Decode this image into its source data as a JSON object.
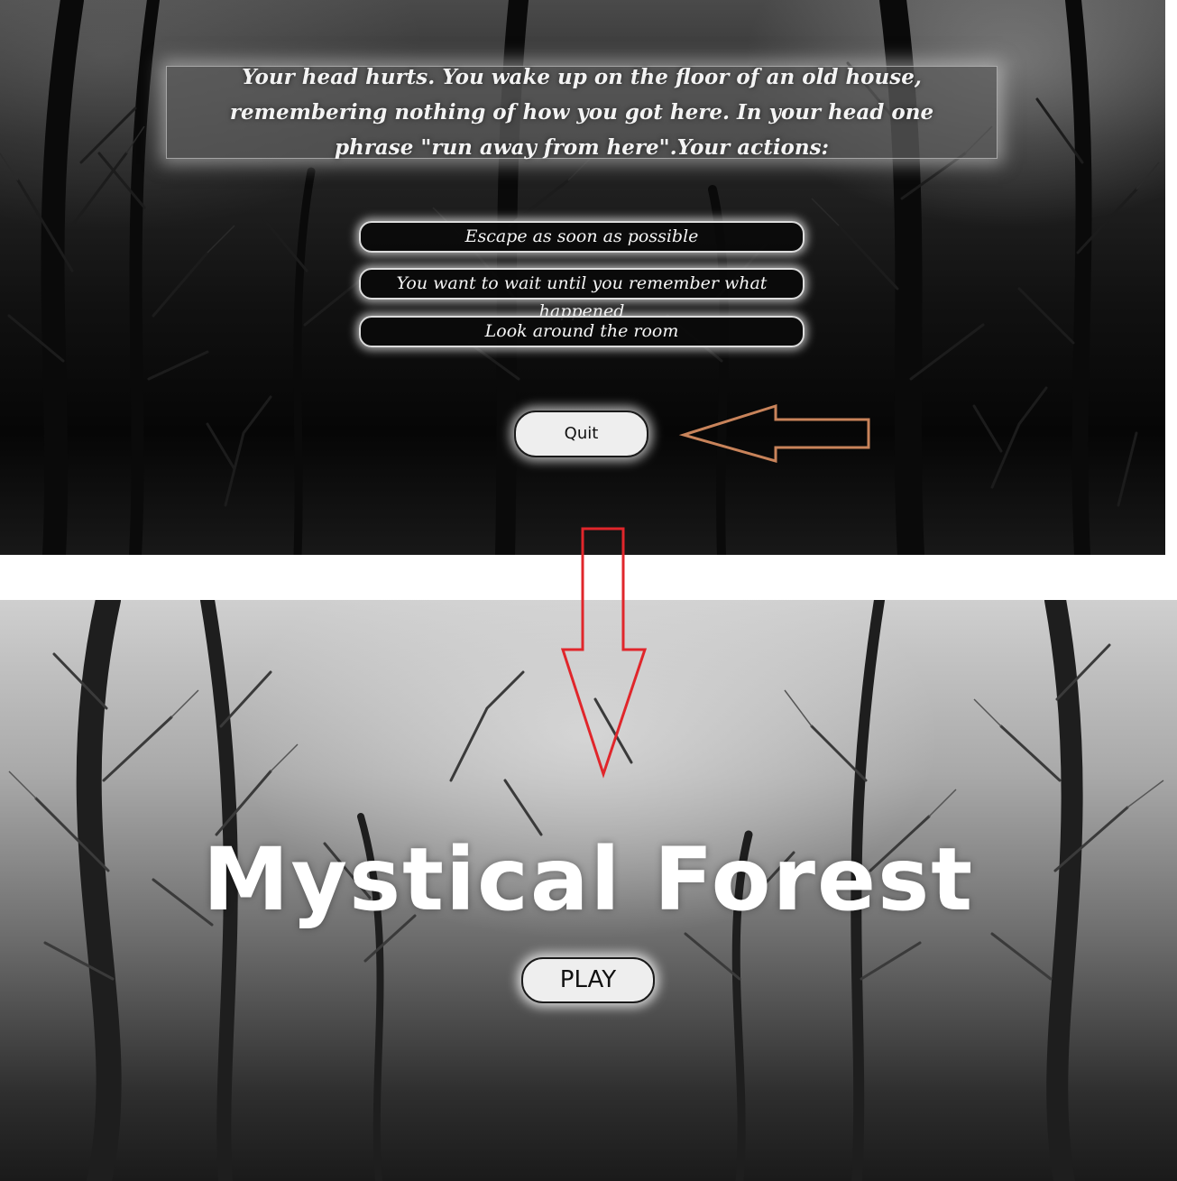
{
  "game_screen": {
    "story_text": "Your head hurts. You wake up on the floor of an old house, remembering nothing of how you got here. In your head one phrase \"run away from here\".Your actions:",
    "choices": [
      {
        "label": "Escape as soon as possible"
      },
      {
        "label": "You want to wait until you remember what happened"
      },
      {
        "label": "Look around the room"
      }
    ],
    "quit_label": "Quit"
  },
  "title_screen": {
    "title": "Mystical Forest",
    "play_label": "PLAY"
  },
  "annotations": {
    "pointer_arrow_color": "#c8835a",
    "flow_arrow_color": "#e0262b"
  }
}
